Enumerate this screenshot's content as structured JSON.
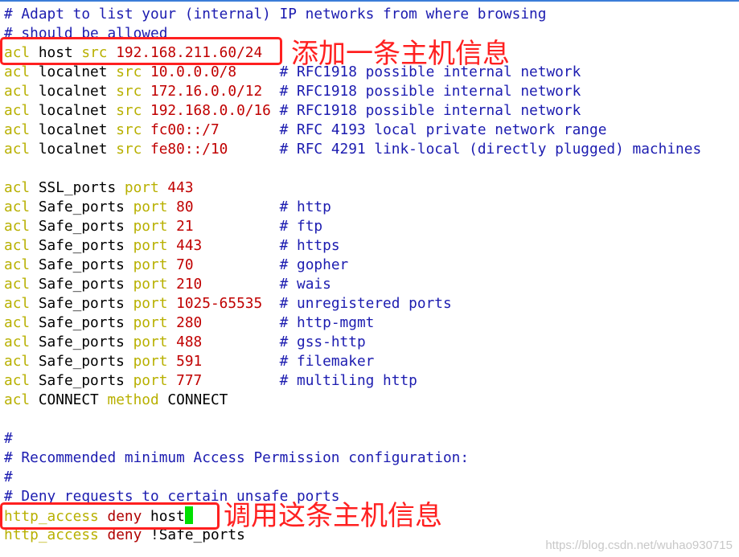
{
  "colors": {
    "comment": "#1c1cb0",
    "keyword": "#b8b000",
    "value": "#c00000",
    "text": "#000000",
    "annotation": "#ff2020",
    "cursor": "#00e000"
  },
  "lines": [
    [
      [
        "# Adapt to list your (internal) IP networks from where browsing",
        "c"
      ]
    ],
    [
      [
        "# should be allowed",
        "c"
      ]
    ],
    [
      [
        "acl",
        "k"
      ],
      [
        " host ",
        "t"
      ],
      [
        "src",
        "k"
      ],
      [
        " 192.168.211.60/24",
        "n"
      ]
    ],
    [
      [
        "acl",
        "k"
      ],
      [
        " localnet ",
        "t"
      ],
      [
        "src",
        "k"
      ],
      [
        " 10.0.0.0/8",
        "n"
      ],
      [
        "     # RFC1918 possible internal network",
        "c"
      ]
    ],
    [
      [
        "acl",
        "k"
      ],
      [
        " localnet ",
        "t"
      ],
      [
        "src",
        "k"
      ],
      [
        " 172.16.0.0/12",
        "n"
      ],
      [
        "  # RFC1918 possible internal network",
        "c"
      ]
    ],
    [
      [
        "acl",
        "k"
      ],
      [
        " localnet ",
        "t"
      ],
      [
        "src",
        "k"
      ],
      [
        " 192.168.0.0/16",
        "n"
      ],
      [
        " # RFC1918 possible internal network",
        "c"
      ]
    ],
    [
      [
        "acl",
        "k"
      ],
      [
        " localnet ",
        "t"
      ],
      [
        "src",
        "k"
      ],
      [
        " fc00::/7",
        "n"
      ],
      [
        "       # RFC 4193 local private network range",
        "c"
      ]
    ],
    [
      [
        "acl",
        "k"
      ],
      [
        " localnet ",
        "t"
      ],
      [
        "src",
        "k"
      ],
      [
        " fe80::/10",
        "n"
      ],
      [
        "      # RFC 4291 link-local (directly plugged) machines",
        "c"
      ]
    ],
    [],
    [
      [
        "acl",
        "k"
      ],
      [
        " SSL_ports ",
        "t"
      ],
      [
        "port",
        "k"
      ],
      [
        " 443",
        "n"
      ]
    ],
    [
      [
        "acl",
        "k"
      ],
      [
        " Safe_ports ",
        "t"
      ],
      [
        "port",
        "k"
      ],
      [
        " 80",
        "n"
      ],
      [
        "          # http",
        "c"
      ]
    ],
    [
      [
        "acl",
        "k"
      ],
      [
        " Safe_ports ",
        "t"
      ],
      [
        "port",
        "k"
      ],
      [
        " 21",
        "n"
      ],
      [
        "          # ftp",
        "c"
      ]
    ],
    [
      [
        "acl",
        "k"
      ],
      [
        " Safe_ports ",
        "t"
      ],
      [
        "port",
        "k"
      ],
      [
        " 443",
        "n"
      ],
      [
        "         # https",
        "c"
      ]
    ],
    [
      [
        "acl",
        "k"
      ],
      [
        " Safe_ports ",
        "t"
      ],
      [
        "port",
        "k"
      ],
      [
        " 70",
        "n"
      ],
      [
        "          # gopher",
        "c"
      ]
    ],
    [
      [
        "acl",
        "k"
      ],
      [
        " Safe_ports ",
        "t"
      ],
      [
        "port",
        "k"
      ],
      [
        " 210",
        "n"
      ],
      [
        "         # wais",
        "c"
      ]
    ],
    [
      [
        "acl",
        "k"
      ],
      [
        " Safe_ports ",
        "t"
      ],
      [
        "port",
        "k"
      ],
      [
        " 1025-65535",
        "n"
      ],
      [
        "  # unregistered ports",
        "c"
      ]
    ],
    [
      [
        "acl",
        "k"
      ],
      [
        " Safe_ports ",
        "t"
      ],
      [
        "port",
        "k"
      ],
      [
        " 280",
        "n"
      ],
      [
        "         # http-mgmt",
        "c"
      ]
    ],
    [
      [
        "acl",
        "k"
      ],
      [
        " Safe_ports ",
        "t"
      ],
      [
        "port",
        "k"
      ],
      [
        " 488",
        "n"
      ],
      [
        "         # gss-http",
        "c"
      ]
    ],
    [
      [
        "acl",
        "k"
      ],
      [
        " Safe_ports ",
        "t"
      ],
      [
        "port",
        "k"
      ],
      [
        " 591",
        "n"
      ],
      [
        "         # filemaker",
        "c"
      ]
    ],
    [
      [
        "acl",
        "k"
      ],
      [
        " Safe_ports ",
        "t"
      ],
      [
        "port",
        "k"
      ],
      [
        " 777",
        "n"
      ],
      [
        "         # multiling http",
        "c"
      ]
    ],
    [
      [
        "acl",
        "k"
      ],
      [
        " CONNECT ",
        "t"
      ],
      [
        "method",
        "k"
      ],
      [
        " CONNECT",
        "t"
      ]
    ],
    [],
    [
      [
        "#",
        "c"
      ]
    ],
    [
      [
        "# Recommended minimum Access Permission configuration:",
        "c"
      ]
    ],
    [
      [
        "#",
        "c"
      ]
    ],
    [
      [
        "# Deny requests to certain unsafe ports",
        "c"
      ]
    ],
    [
      [
        "http_access",
        "k"
      ],
      [
        " ",
        "t"
      ],
      [
        "deny",
        "d"
      ],
      [
        " host",
        "t"
      ]
    ],
    [
      [
        "http_access",
        "k"
      ],
      [
        " ",
        "t"
      ],
      [
        "deny",
        "d"
      ],
      [
        " !Safe_ports",
        "t"
      ]
    ]
  ],
  "annotations": {
    "add_host": "添加一条主机信息",
    "use_host": "调用这条主机信息"
  },
  "watermark": "https://blog.csdn.net/wuhao930715"
}
